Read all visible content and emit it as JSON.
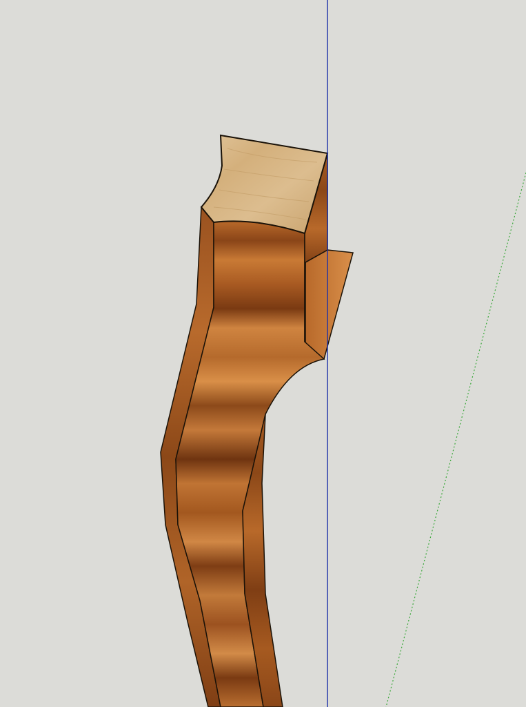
{
  "app": {
    "view": "3d-model-viewport",
    "background_color": "#dcdcd8"
  },
  "axes": {
    "blue_axis_color": "#1a2fa8",
    "green_axis_color": "#3aa83a"
  },
  "model": {
    "object": "cabriole-leg",
    "end_grain_color": "#d9b98a",
    "wood_colors": [
      "#c9772e",
      "#a9571f",
      "#7a3c14",
      "#e0954a"
    ],
    "edge_color": "#1a1208"
  }
}
